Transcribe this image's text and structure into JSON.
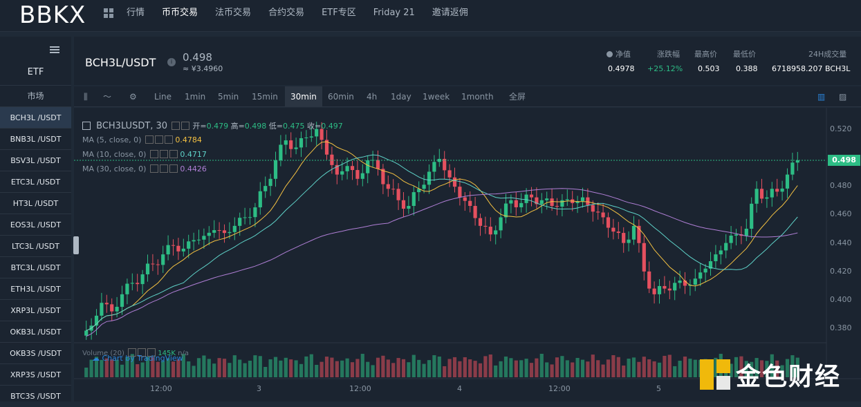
{
  "brand": "BBKX",
  "nav": [
    "行情",
    "币币交易",
    "法币交易",
    "合约交易",
    "ETF专区",
    "Friday 21",
    "邀请返佣"
  ],
  "nav_active": 1,
  "sidebar": {
    "category": "ETF",
    "market_label": "市场",
    "items": [
      "BCH3L /USDT",
      "BNB3L /USDT",
      "BSV3L /USDT",
      "ETC3L /USDT",
      "HT3L /USDT",
      "EOS3L /USDT",
      "LTC3L /USDT",
      "BTC3L /USDT",
      "ETH3L /USDT",
      "XRP3L /USDT",
      "OKB3L /USDT",
      "OKB3S /USDT",
      "XRP3S /USDT",
      "BTC3S /USDT"
    ],
    "active_index": 0
  },
  "header": {
    "pair": "BCH3L/USDT",
    "info_icon": "i",
    "price": "0.498",
    "price_cny": "≈ ¥3.4960",
    "stats": [
      {
        "label": "净值",
        "value": "0.4978"
      },
      {
        "label": "涨跌幅",
        "value": "+25.12%"
      },
      {
        "label": "最高价",
        "value": "0.503"
      },
      {
        "label": "最低价",
        "value": "0.388"
      },
      {
        "label": "24H成交量",
        "value": "6718958.207 BCH3L"
      }
    ]
  },
  "toolbar": {
    "intervals": [
      "Line",
      "1min",
      "5min",
      "15min",
      "30min",
      "60min",
      "4h",
      "1day",
      "1week",
      "1month"
    ],
    "active": "30min",
    "fullscreen": "全屏"
  },
  "chart_legend": {
    "symbol": "BCH3LUSDT, 30",
    "open_label": "开=",
    "open": "0.479",
    "high_label": "高=",
    "high": "0.498",
    "low_label": "低=",
    "low": "0.475",
    "close_label": "收=",
    "close": "0.497",
    "ma5_label": "MA (5, close, 0)",
    "ma5": "0.4784",
    "ma10_label": "MA (10, close, 0)",
    "ma10": "0.4717",
    "ma30_label": "MA (30, close, 0)",
    "ma30": "0.4426",
    "volume_label": "Volume (20)",
    "volume_value": "145K",
    "volume_extra": "n/a",
    "credit": "Chart by TradingView",
    "last_price": "0.498"
  },
  "watermark": "金色财经",
  "colors": {
    "up": "#2dbd85",
    "down": "#e5505f",
    "ma5": "#f5c242",
    "ma10": "#5fd3c9",
    "ma30": "#b07fd6"
  },
  "chart_data": {
    "type": "candlestick",
    "y_ticks": [
      "0.520",
      "0.480",
      "0.460",
      "0.440",
      "0.420",
      "0.400",
      "0.380"
    ],
    "x_ticks": [
      "12:00",
      "3",
      "12:00",
      "4",
      "12:00",
      "5"
    ],
    "ylim": [
      0.37,
      0.53
    ],
    "closes": [
      0.382,
      0.398,
      0.392,
      0.404,
      0.412,
      0.418,
      0.425,
      0.432,
      0.438,
      0.436,
      0.442,
      0.445,
      0.449,
      0.447,
      0.452,
      0.458,
      0.465,
      0.48,
      0.498,
      0.512,
      0.507,
      0.514,
      0.52,
      0.502,
      0.488,
      0.494,
      0.485,
      0.498,
      0.492,
      0.478,
      0.47,
      0.466,
      0.478,
      0.49,
      0.499,
      0.486,
      0.472,
      0.466,
      0.452,
      0.446,
      0.458,
      0.47,
      0.468,
      0.472,
      0.47,
      0.466,
      0.47,
      0.468,
      0.472,
      0.462,
      0.458,
      0.448,
      0.44,
      0.452,
      0.42,
      0.404,
      0.408,
      0.412,
      0.41,
      0.415,
      0.422,
      0.432,
      0.44,
      0.446,
      0.45,
      0.478,
      0.472,
      0.476,
      0.488,
      0.498
    ]
  }
}
